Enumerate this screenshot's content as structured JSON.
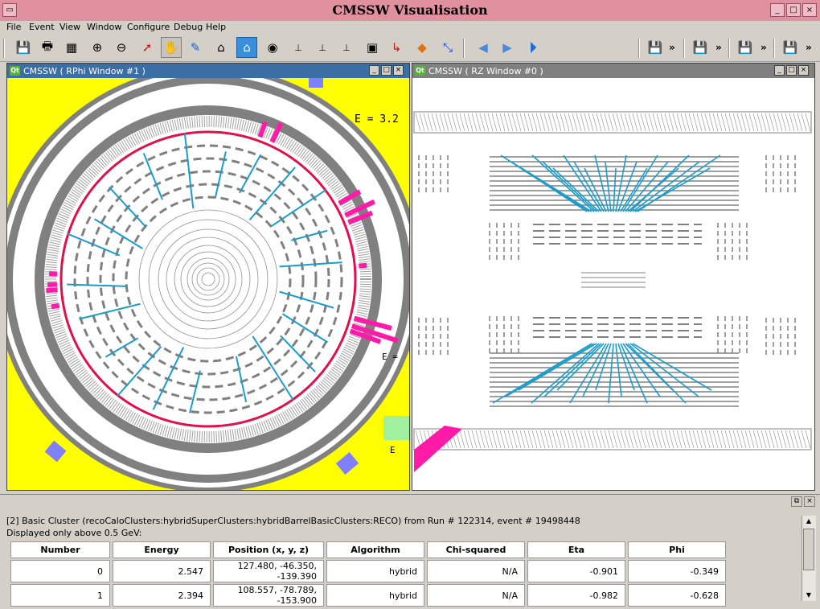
{
  "window": {
    "title": "CMSSW Visualisation"
  },
  "menu": [
    "File",
    "Event",
    "View",
    "Window",
    "Configure",
    "Debug",
    "Help"
  ],
  "toolbar": {
    "icons": [
      "save-icon",
      "print-icon",
      "film-icon",
      "zoom-in-icon",
      "zoom-out-icon",
      "select-arrow-icon",
      "pan-hand-icon",
      "pick-icon",
      "home-icon",
      "set-home-icon",
      "view-all-icon",
      "axes-zy-icon",
      "axes-xz-icon",
      "axes-xy-icon",
      "snapshot-icon",
      "axes-icon",
      "cube-icon",
      "pointer-icon",
      "back-icon",
      "forward-icon",
      "play-icon"
    ],
    "right_chevron": "»"
  },
  "rphi": {
    "title": "CMSSW ( RPhi Window #1 )",
    "labels": {
      "e_value": "E = 3.2",
      "e_small": "E =",
      "e_corner": "E"
    }
  },
  "rz": {
    "title": "CMSSW ( RZ Window #0 )"
  },
  "subwin_buttons": {
    "minimize": "_",
    "maximize": "□",
    "close": "×"
  },
  "panel": {
    "line1": "[2] Basic Cluster (recoCaloClusters:hybridSuperClusters:hybridBarrelBasicClusters:RECO) from Run # 122314, event # 19498448",
    "line2": "Displayed only above 0.5 GeV:",
    "columns": [
      "Number",
      "Energy",
      "Position (x, y, z)",
      "Algorithm",
      "Chi-squared",
      "Eta",
      "Phi"
    ],
    "rows": [
      [
        "0",
        "2.547",
        "127.480, -46.350, -139.390",
        "hybrid",
        "N/A",
        "-0.901",
        "-0.349"
      ],
      [
        "1",
        "2.394",
        "108.557, -78.789, -153.900",
        "hybrid",
        "N/A",
        "-0.982",
        "-0.628"
      ]
    ]
  },
  "colors": {
    "title_bg": "#e0909e",
    "accent_magenta": "#ff1aa8",
    "track_cyan": "#1a9ccc",
    "red_circle": "#e0104a",
    "yellow": "#ffff00"
  }
}
